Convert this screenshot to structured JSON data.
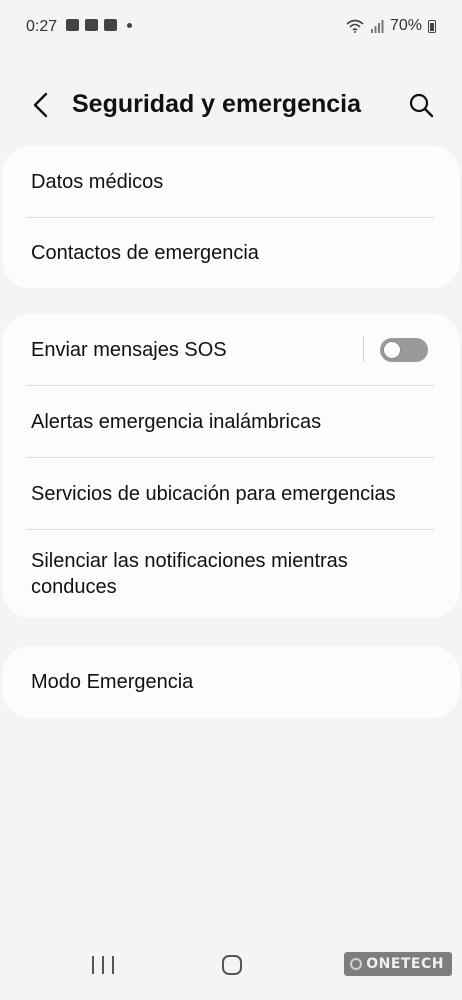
{
  "status_bar": {
    "time": "0:27",
    "notification_icons": [
      "image-icon",
      "mail-icon",
      "linkedin-icon"
    ],
    "wifi": "wifi-icon",
    "signal": "signal-icon",
    "battery_text": "70%"
  },
  "header": {
    "title": "Seguridad y emergencia",
    "back_icon": "back-arrow-icon",
    "search_icon": "search-icon"
  },
  "cards": [
    {
      "items": [
        {
          "label": "Datos médicos"
        },
        {
          "label": "Contactos de emergencia"
        }
      ]
    },
    {
      "items": [
        {
          "label": "Enviar mensajes SOS",
          "toggle": false
        },
        {
          "label": "Alertas emergencia inalámbricas"
        },
        {
          "label": "Servicios de ubicación para emergencias"
        },
        {
          "label": "Silenciar las notificaciones mientras conduces"
        }
      ]
    },
    {
      "items": [
        {
          "label": "Modo Emergencia"
        }
      ]
    }
  ],
  "nav_bar": {
    "recents": "recents-icon",
    "home": "home-icon",
    "back": "back-icon"
  },
  "watermark": {
    "text": "ONETECH"
  },
  "colors": {
    "background": "#f4f4f4",
    "card": "#fcfcfc",
    "toggle_off": "#9a9a9a"
  }
}
